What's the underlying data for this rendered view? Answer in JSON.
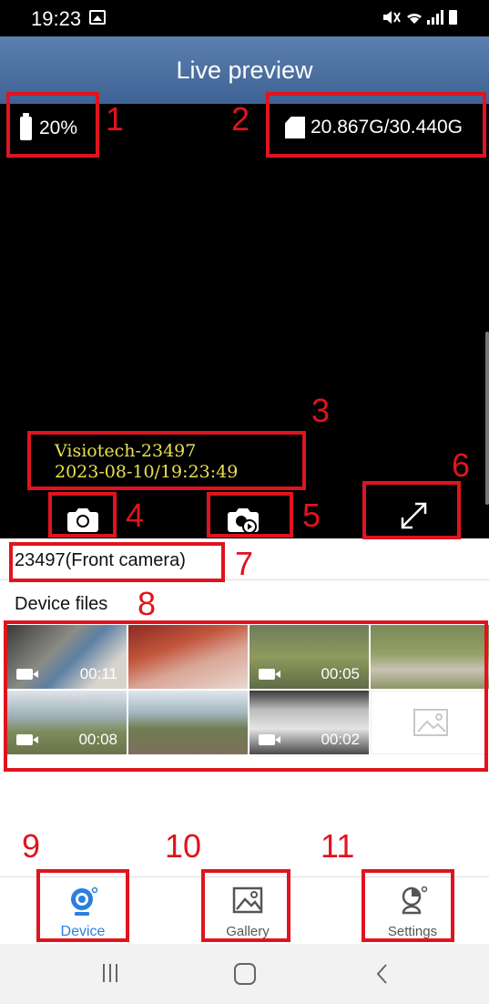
{
  "status_bar": {
    "time": "19:23",
    "right_icons": "mute wifi signal battery"
  },
  "header": {
    "title": "Live preview"
  },
  "preview": {
    "battery_text": "20%",
    "storage_text": "20.867G/30.440G",
    "osd_device": "Visiotech-23497",
    "osd_timestamp": "2023-08-10/19:23:49"
  },
  "camera": {
    "name": "23497(Front camera)"
  },
  "files": {
    "title": "Device files",
    "thumbnails": [
      {
        "duration": "00:11",
        "type": "video"
      },
      {
        "duration": "",
        "type": "image"
      },
      {
        "duration": "00:05",
        "type": "video"
      },
      {
        "duration": "",
        "type": "image"
      },
      {
        "duration": "00:08",
        "type": "video"
      },
      {
        "duration": "",
        "type": "image"
      },
      {
        "duration": "00:02",
        "type": "video"
      },
      {
        "duration": "",
        "type": "placeholder"
      }
    ]
  },
  "nav": {
    "items": [
      {
        "label": "Device",
        "active": true
      },
      {
        "label": "Gallery",
        "active": false
      },
      {
        "label": "Settings",
        "active": false
      }
    ]
  },
  "annotations": [
    "1",
    "2",
    "3",
    "4",
    "5",
    "6",
    "7",
    "8",
    "9",
    "10",
    "11"
  ],
  "colors": {
    "accent": "#2a7fe0",
    "annotation": "#e0141e",
    "header": "#4a6fa0",
    "osd_text": "#e8e050"
  }
}
